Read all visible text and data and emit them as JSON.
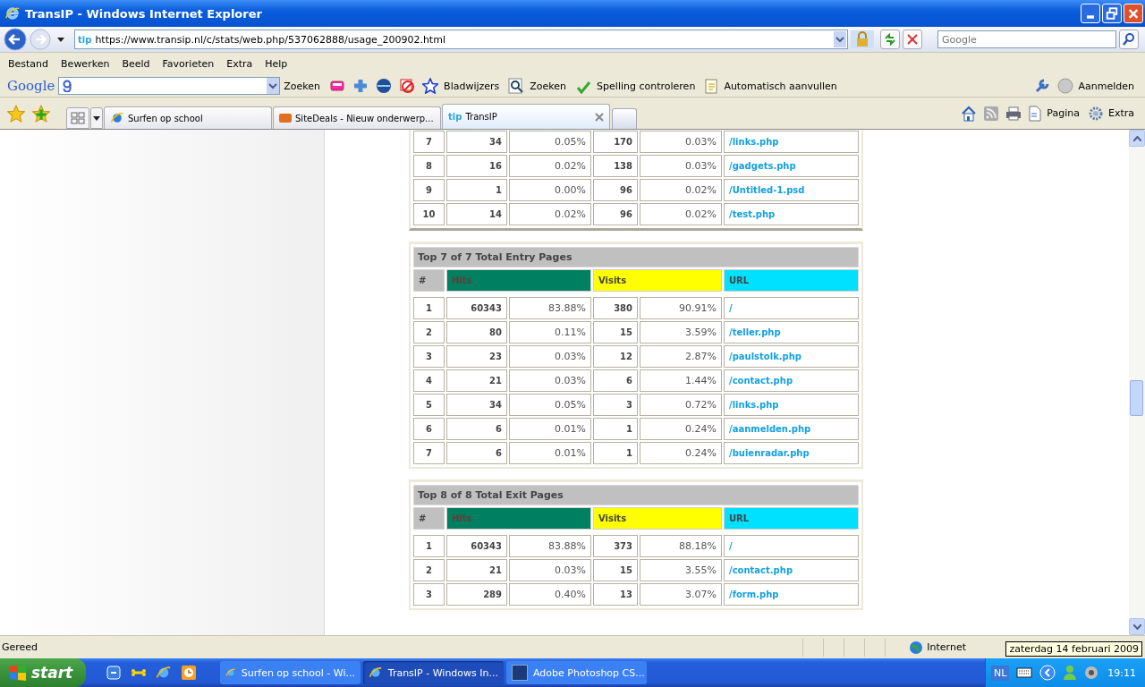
{
  "window": {
    "title": "TransIP - Windows Internet Explorer"
  },
  "nav": {
    "favicon": "tip",
    "url": "https://www.transip.nl/c/stats/web.php/537062888/usage_200902.html",
    "search_placeholder": "Google"
  },
  "menu": [
    "Bestand",
    "Bewerken",
    "Beeld",
    "Favorieten",
    "Extra",
    "Help"
  ],
  "google_toolbar": {
    "logo": "Google",
    "search_button": "Zoeken",
    "bookmarks": "Bladwijzers",
    "find": "Zoeken",
    "spelling": "Spelling controleren",
    "autofill": "Automatisch aanvullen",
    "signin": "Aanmelden"
  },
  "tabs": [
    {
      "label": "Surfen op school",
      "selected": false
    },
    {
      "label": "SiteDeals - Nieuw onderwerp...",
      "selected": false
    },
    {
      "label": "TransIP",
      "selected": true,
      "favicon": "tip"
    }
  ],
  "command_bar": [
    "Pagina",
    "Extra"
  ],
  "tables": [
    {
      "rows": [
        [
          "7",
          "34",
          "0.05%",
          "170",
          "0.03%",
          "/links.php"
        ],
        [
          "8",
          "16",
          "0.02%",
          "138",
          "0.03%",
          "/gadgets.php"
        ],
        [
          "9",
          "1",
          "0.00%",
          "96",
          "0.02%",
          "/Untitled-1.psd"
        ],
        [
          "10",
          "14",
          "0.02%",
          "96",
          "0.02%",
          "/test.php"
        ]
      ]
    },
    {
      "title": "Top 7 of 7 Total Entry Pages",
      "headers": [
        {
          "label": "#",
          "color": "#c0c0c0"
        },
        {
          "label": "Hits",
          "color": "#008060"
        },
        {
          "label": "Visits",
          "color": "#ffff00"
        },
        {
          "label": "URL",
          "color": "#00e0ff"
        }
      ],
      "rows": [
        [
          "1",
          "60343",
          "83.88%",
          "380",
          "90.91%",
          "/"
        ],
        [
          "2",
          "80",
          "0.11%",
          "15",
          "3.59%",
          "/teller.php"
        ],
        [
          "3",
          "23",
          "0.03%",
          "12",
          "2.87%",
          "/paulstolk.php"
        ],
        [
          "4",
          "21",
          "0.03%",
          "6",
          "1.44%",
          "/contact.php"
        ],
        [
          "5",
          "34",
          "0.05%",
          "3",
          "0.72%",
          "/links.php"
        ],
        [
          "6",
          "6",
          "0.01%",
          "1",
          "0.24%",
          "/aanmelden.php"
        ],
        [
          "7",
          "6",
          "0.01%",
          "1",
          "0.24%",
          "/buienradar.php"
        ]
      ]
    },
    {
      "title": "Top 8 of 8 Total Exit Pages",
      "headers": [
        {
          "label": "#",
          "color": "#c0c0c0"
        },
        {
          "label": "Hits",
          "color": "#008060"
        },
        {
          "label": "Visits",
          "color": "#ffff00"
        },
        {
          "label": "URL",
          "color": "#00e0ff"
        }
      ],
      "rows": [
        [
          "1",
          "60343",
          "83.88%",
          "373",
          "88.18%",
          "/"
        ],
        [
          "2",
          "21",
          "0.03%",
          "15",
          "3.55%",
          "/contact.php"
        ],
        [
          "3",
          "289",
          "0.40%",
          "13",
          "3.07%",
          "/form.php"
        ]
      ]
    }
  ],
  "status": {
    "text": "Gereed",
    "zone": "Internet"
  },
  "taskbar": {
    "start": "start",
    "tasks": [
      {
        "label": "Surfen op school - Wi...",
        "selected": false
      },
      {
        "label": "TransIP - Windows In...",
        "selected": true
      },
      {
        "label": "Adobe Photoshop CS...",
        "selected": false
      }
    ],
    "language": "NL",
    "time": "19:11",
    "tooltip": "zaterdag 14 februari 2009"
  }
}
